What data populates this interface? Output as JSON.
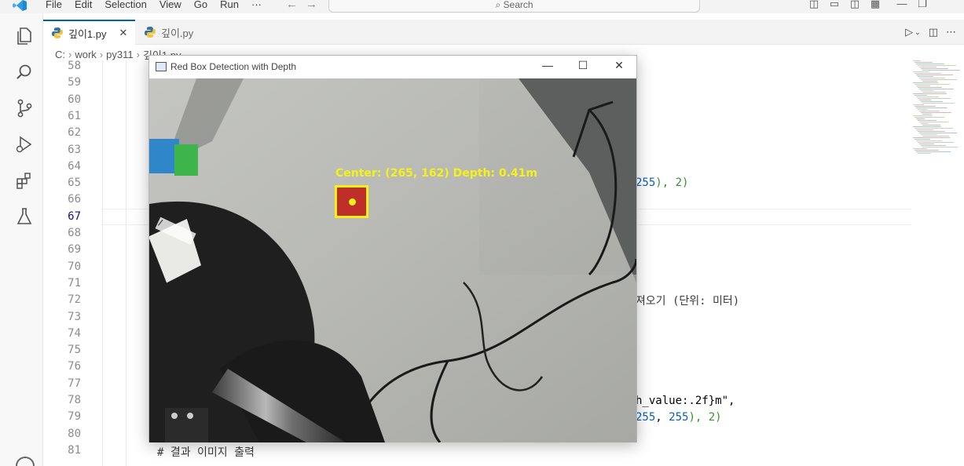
{
  "titlebar": {
    "menu": [
      "File",
      "Edit",
      "Selection",
      "View",
      "Go",
      "Run",
      "···"
    ],
    "search_placeholder": "Search"
  },
  "tabs": [
    {
      "label": "깊이1.py",
      "active": true
    },
    {
      "label": "깊이.py",
      "active": false
    }
  ],
  "breadcrumb": [
    "C:",
    "work",
    "py311",
    "깊이1.py"
  ],
  "editor": {
    "current_line": 67,
    "line_numbers": [
      58,
      59,
      60,
      61,
      62,
      63,
      64,
      65,
      66,
      67,
      68,
      69,
      70,
      71,
      72,
      73,
      74,
      75,
      76,
      77,
      78,
      79,
      80,
      81
    ],
    "visible_code": {
      "line65": {
        "a": "255",
        "b": "), 2)"
      },
      "line72": "가져오기 (단위: 미터)",
      "line78": {
        "text": "h_value:.2f}m\","
      },
      "line79": {
        "a": "255",
        "b": ", ",
        "c": "255",
        "d": "), 2)"
      },
      "line81": "# 결과 이미지 출력"
    }
  },
  "popup": {
    "title": "Red Box Detection with Depth",
    "controls": {
      "minimize": "—",
      "maximize": "☐",
      "close": "✕"
    },
    "detection_label": "Center: (265, 162) Depth: 0.41m"
  },
  "colors": {
    "accent": "#005fb8",
    "detection_yellow": "#f5f218",
    "box_red": "#c02e2a"
  }
}
